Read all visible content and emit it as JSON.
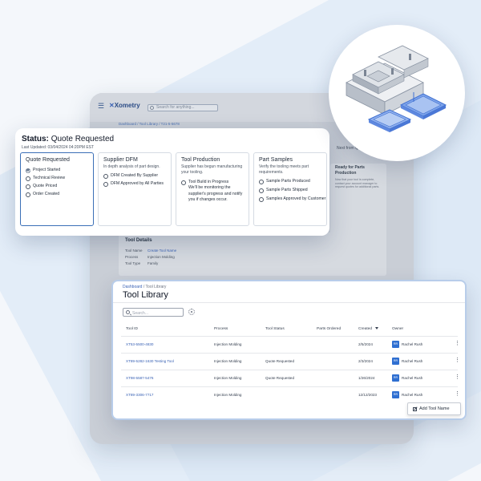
{
  "app": {
    "brand": "Xometry",
    "search_placeholder": "Search for anything...",
    "breadcrumb": "Dashboard / Tool Library / T21-5-5678",
    "side_label": "Next from Quote",
    "side_card_title": "Ready for Parts Production",
    "side_card_text": "Now that your tool is complete, contact your account manager to request quotes for additional parts.",
    "tool_details": {
      "title": "Tool Details",
      "rows": [
        {
          "label": "Tool Name",
          "value": "Create Tool Name"
        },
        {
          "label": "Process",
          "value": "Injection Molding"
        },
        {
          "label": "Tool Type",
          "value": "Family"
        }
      ]
    }
  },
  "status": {
    "label": "Status:",
    "value": "Quote Requested",
    "updated": "Last Updated: 03/04/2024 04:20PM EST",
    "stages": [
      {
        "title": "Quote Requested",
        "description": "",
        "active": true,
        "steps": [
          {
            "label": "Project Started",
            "done": true
          },
          {
            "label": "Technical Review",
            "done": false
          },
          {
            "label": "Quote Priced",
            "done": false
          },
          {
            "label": "Order Created",
            "done": false
          }
        ]
      },
      {
        "title": "Supplier DFM",
        "description": "In depth analysis of part design.",
        "active": false,
        "steps": [
          {
            "label": "DFM Created By Supplier",
            "done": false
          },
          {
            "label": "DFM Approved by All Parties",
            "done": false
          }
        ]
      },
      {
        "title": "Tool Production",
        "description": "Supplier has begun manufacturing your tooling.",
        "active": false,
        "steps": [
          {
            "label": "Tool Build in Progress",
            "done": false,
            "note": "We'll be monitoring the supplier's progress and notify you if changes occur."
          }
        ]
      },
      {
        "title": "Part Samples",
        "description": "Verify the tooling meets part requirements.",
        "active": false,
        "steps": [
          {
            "label": "Sample Parts Produced",
            "done": false
          },
          {
            "label": "Sample Parts Shipped",
            "done": false
          },
          {
            "label": "Samples Approved by Customer",
            "done": false
          }
        ]
      }
    ]
  },
  "library": {
    "breadcrumb_link": "Dashboard",
    "breadcrumb_rest": " / Tool Library",
    "title": "Tool Library",
    "search_placeholder": "Search...",
    "columns": [
      "Tool ID",
      "Process",
      "Tool Status",
      "Parts Ordered",
      "Created",
      "Owner"
    ],
    "rows": [
      {
        "id": "XT53-5500-4830",
        "process": "Injection Molding",
        "status": "",
        "parts": "",
        "created": "2/5/2024",
        "owner_initials": "RR",
        "owner": "Rachel Rush"
      },
      {
        "id": "XT89-5282-1630 Testing Tool",
        "process": "Injection Molding",
        "status": "Quote Requested",
        "parts": "",
        "created": "2/3/2024",
        "owner_initials": "RR",
        "owner": "Rachel Rush"
      },
      {
        "id": "XT98-5587-5476",
        "process": "Injection Molding",
        "status": "Quote Requested",
        "parts": "",
        "created": "1/26/2024",
        "owner_initials": "RR",
        "owner": "Rachel Rush"
      },
      {
        "id": "XT89-3306-7717",
        "process": "Injection Molding",
        "status": "",
        "parts": "",
        "created": "12/12/2023",
        "owner_initials": "RR",
        "owner": "Rachel Rush"
      }
    ],
    "add_button": "Add Tool Name"
  },
  "colors": {
    "accent": "#3b63b5",
    "active_border": "#3b6fb7",
    "avatar": "#2f6fd1"
  }
}
